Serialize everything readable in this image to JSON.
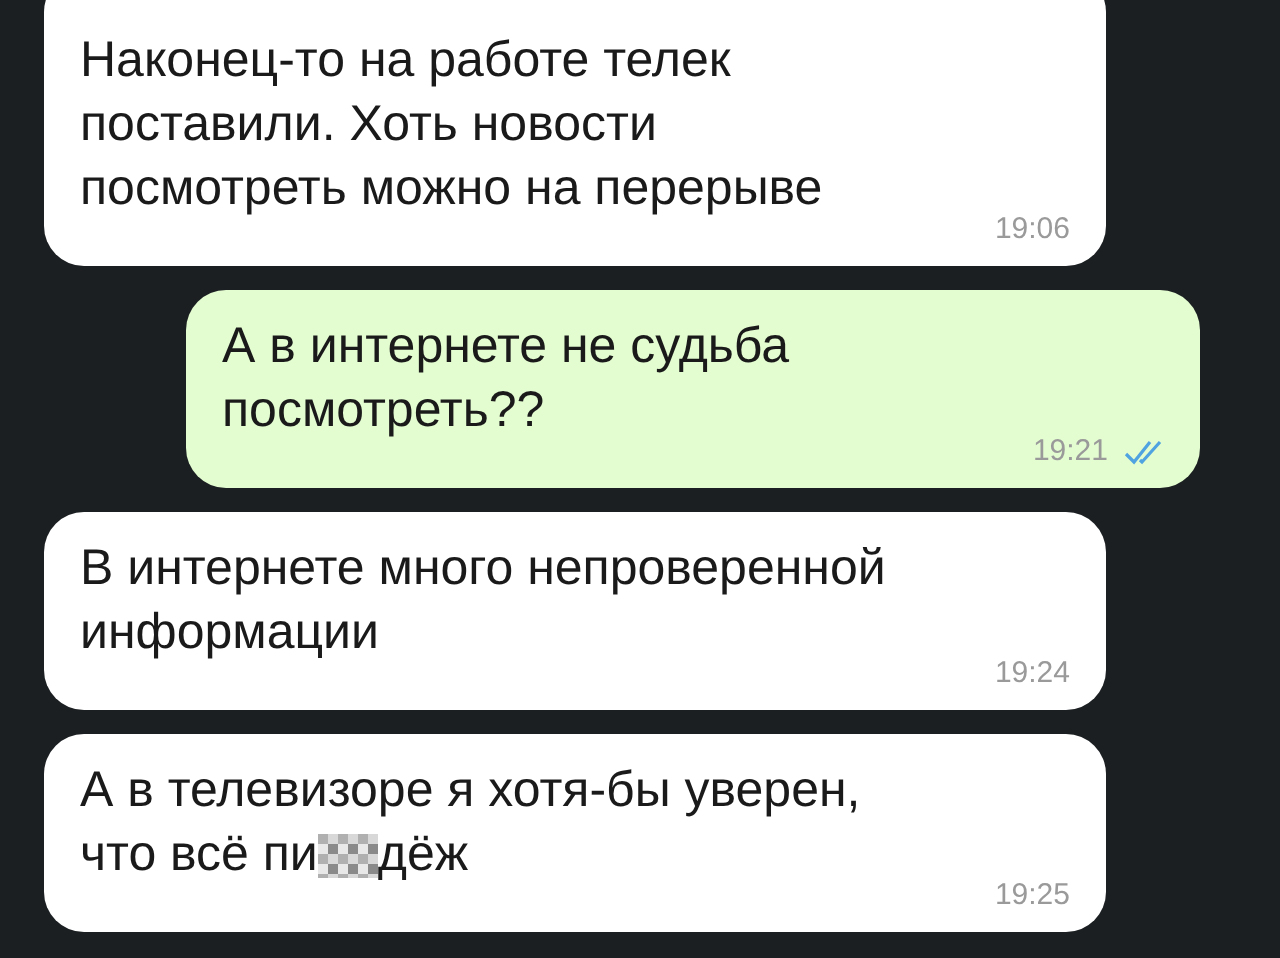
{
  "messages": [
    {
      "kind": "incoming",
      "lines": [
        "Наконец-то на работе телек",
        "поставили. Хоть новости",
        "посмотреть можно на перерыве"
      ],
      "time": "19:06"
    },
    {
      "kind": "outgoing",
      "lines": [
        "А в интернете не судьба",
        "посмотреть??"
      ],
      "time": "19:21",
      "read": true
    },
    {
      "kind": "incoming",
      "lines": [
        "В интернете много непроверенной",
        "информации"
      ],
      "time": "19:24"
    },
    {
      "kind": "incoming",
      "lines": [
        "А в телевизоре я хотя-бы уверен,",
        "что всё пи"
      ],
      "tail": "дёж",
      "time": "19:25"
    }
  ]
}
